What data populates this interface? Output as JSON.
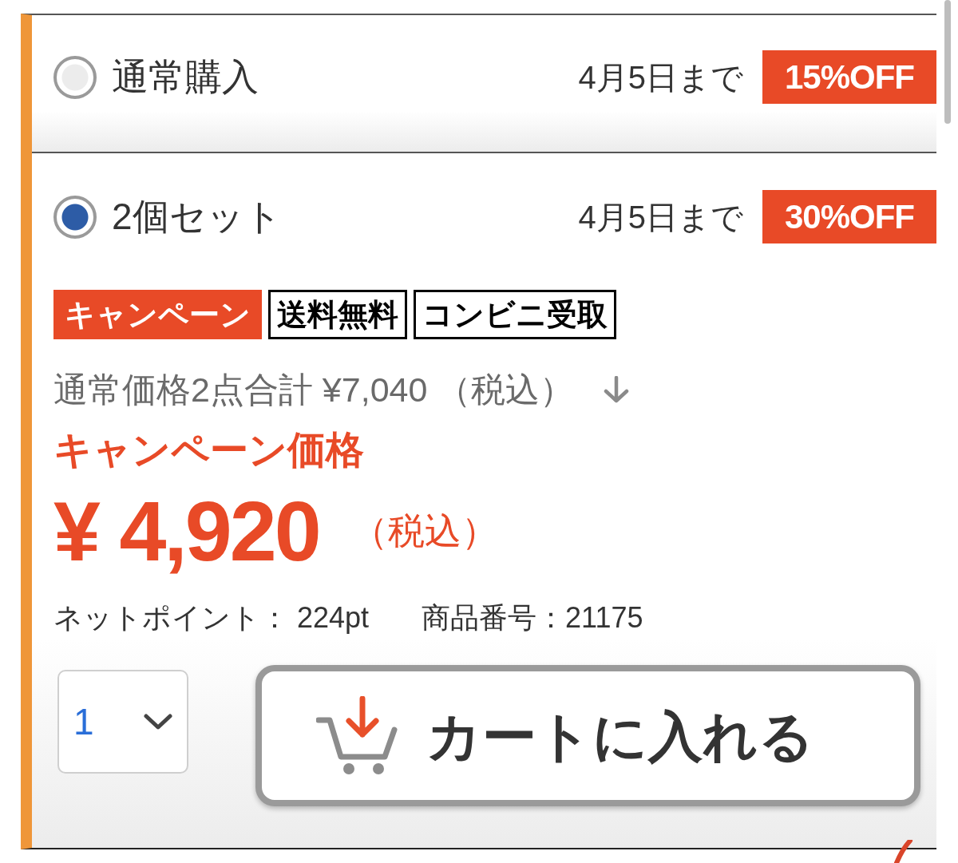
{
  "options": [
    {
      "label": "通常購入",
      "selected": false,
      "deadline": "4月5日まで",
      "discount": "15%OFF"
    },
    {
      "label": "2個セット",
      "selected": true,
      "deadline": "4月5日まで",
      "discount": "30%OFF",
      "details": {
        "tags": [
          {
            "text": "キャンペーン",
            "kind": "filled"
          },
          {
            "text": "送料無料",
            "kind": "outlined"
          },
          {
            "text": "コンビニ受取",
            "kind": "outlined"
          }
        ],
        "regular_price": "通常価格2点合計 ¥7,040 （税込）",
        "campaign_label": "キャンペーン価格",
        "price": "¥ 4,920",
        "price_tax": "（税込）",
        "points": "ネットポイント： 224pt",
        "product_number": "商品番号：21175",
        "quantity": "1",
        "cart_button": "カートに入れる"
      }
    }
  ]
}
